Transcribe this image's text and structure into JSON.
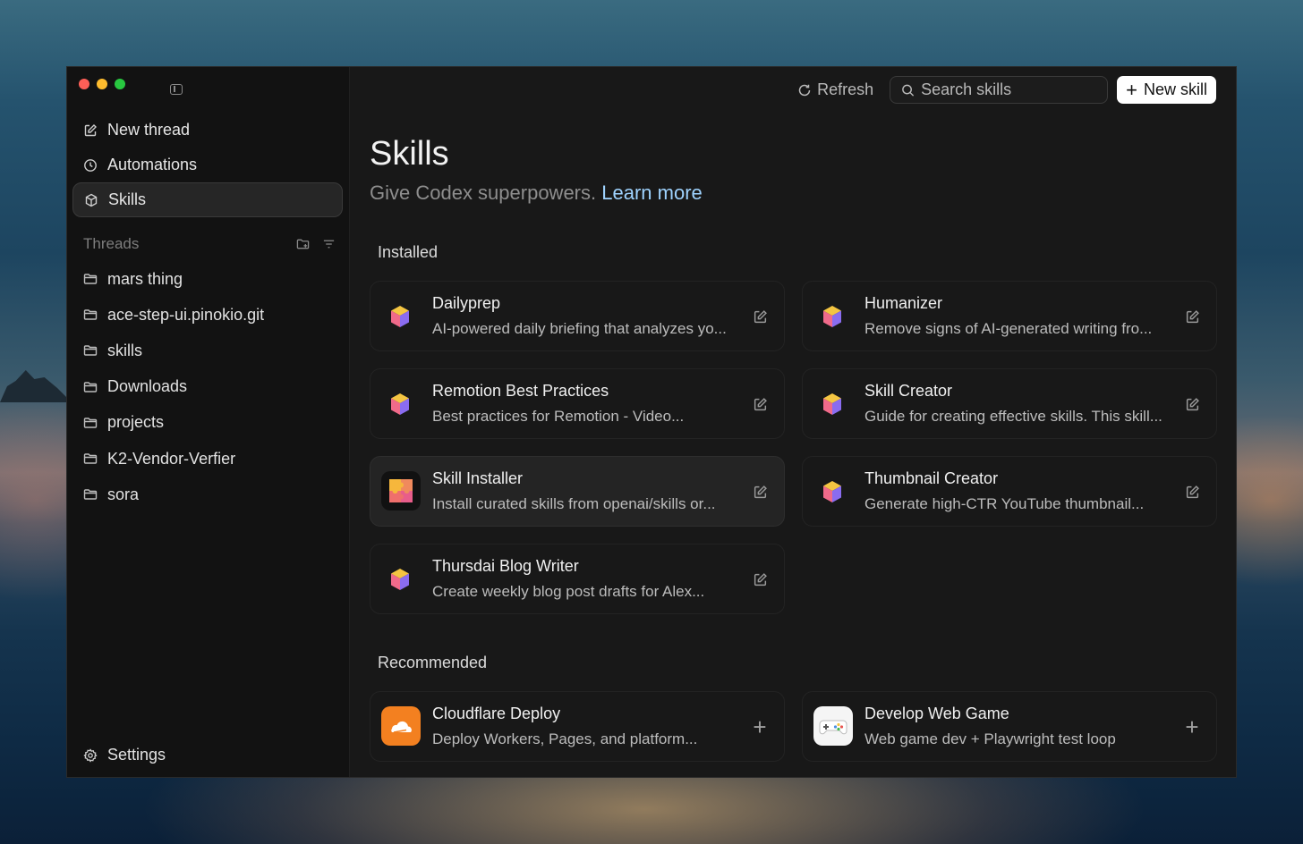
{
  "window": {
    "traffic_lights": [
      "close",
      "minimize",
      "zoom"
    ]
  },
  "sidebar": {
    "nav": [
      {
        "label": "New thread",
        "icon": "edit-icon"
      },
      {
        "label": "Automations",
        "icon": "clock-icon"
      },
      {
        "label": "Skills",
        "icon": "cube-icon",
        "active": true
      }
    ],
    "threads_title": "Threads",
    "threads": [
      "mars thing",
      "ace-step-ui.pinokio.git",
      "skills",
      "Downloads",
      "projects",
      "K2-Vendor-Verfier",
      "sora"
    ],
    "settings_label": "Settings"
  },
  "topbar": {
    "refresh_label": "Refresh",
    "search_placeholder": "Search skills",
    "new_skill_label": "New skill"
  },
  "main": {
    "title": "Skills",
    "subtitle": "Give Codex superpowers.",
    "learn_more": "Learn more",
    "installed_label": "Installed",
    "recommended_label": "Recommended",
    "installed": [
      {
        "title": "Dailyprep",
        "desc": "AI-powered daily briefing that analyzes yo...",
        "icon": "cube-icon"
      },
      {
        "title": "Humanizer",
        "desc": "Remove signs of AI-generated writing fro...",
        "icon": "cube-icon"
      },
      {
        "title": "Remotion Best Practices",
        "desc": "Best practices for Remotion - Video...",
        "icon": "cube-icon"
      },
      {
        "title": "Skill Creator",
        "desc": "Guide for creating effective skills. This skill...",
        "icon": "cube-icon"
      },
      {
        "title": "Skill Installer",
        "desc": "Install curated skills from openai/skills or...",
        "icon": "puzzle-icon"
      },
      {
        "title": "Thumbnail Creator",
        "desc": "Generate high-CTR YouTube thumbnail...",
        "icon": "cube-icon"
      },
      {
        "title": "Thursdai Blog Writer",
        "desc": "Create weekly blog post drafts for Alex...",
        "icon": "cube-icon"
      }
    ],
    "recommended": [
      {
        "title": "Cloudflare Deploy",
        "desc": "Deploy Workers, Pages, and platform...",
        "icon": "cloudflare-icon"
      },
      {
        "title": "Develop Web Game",
        "desc": "Web game dev + Playwright test loop",
        "icon": "gamepad-icon"
      }
    ]
  },
  "colors": {
    "accent_link": "#9fd3ff",
    "cube_top": "#f4c542",
    "cube_left": "#f06a8a",
    "cube_right": "#8a6cf0",
    "cloudflare": "#f38020"
  }
}
